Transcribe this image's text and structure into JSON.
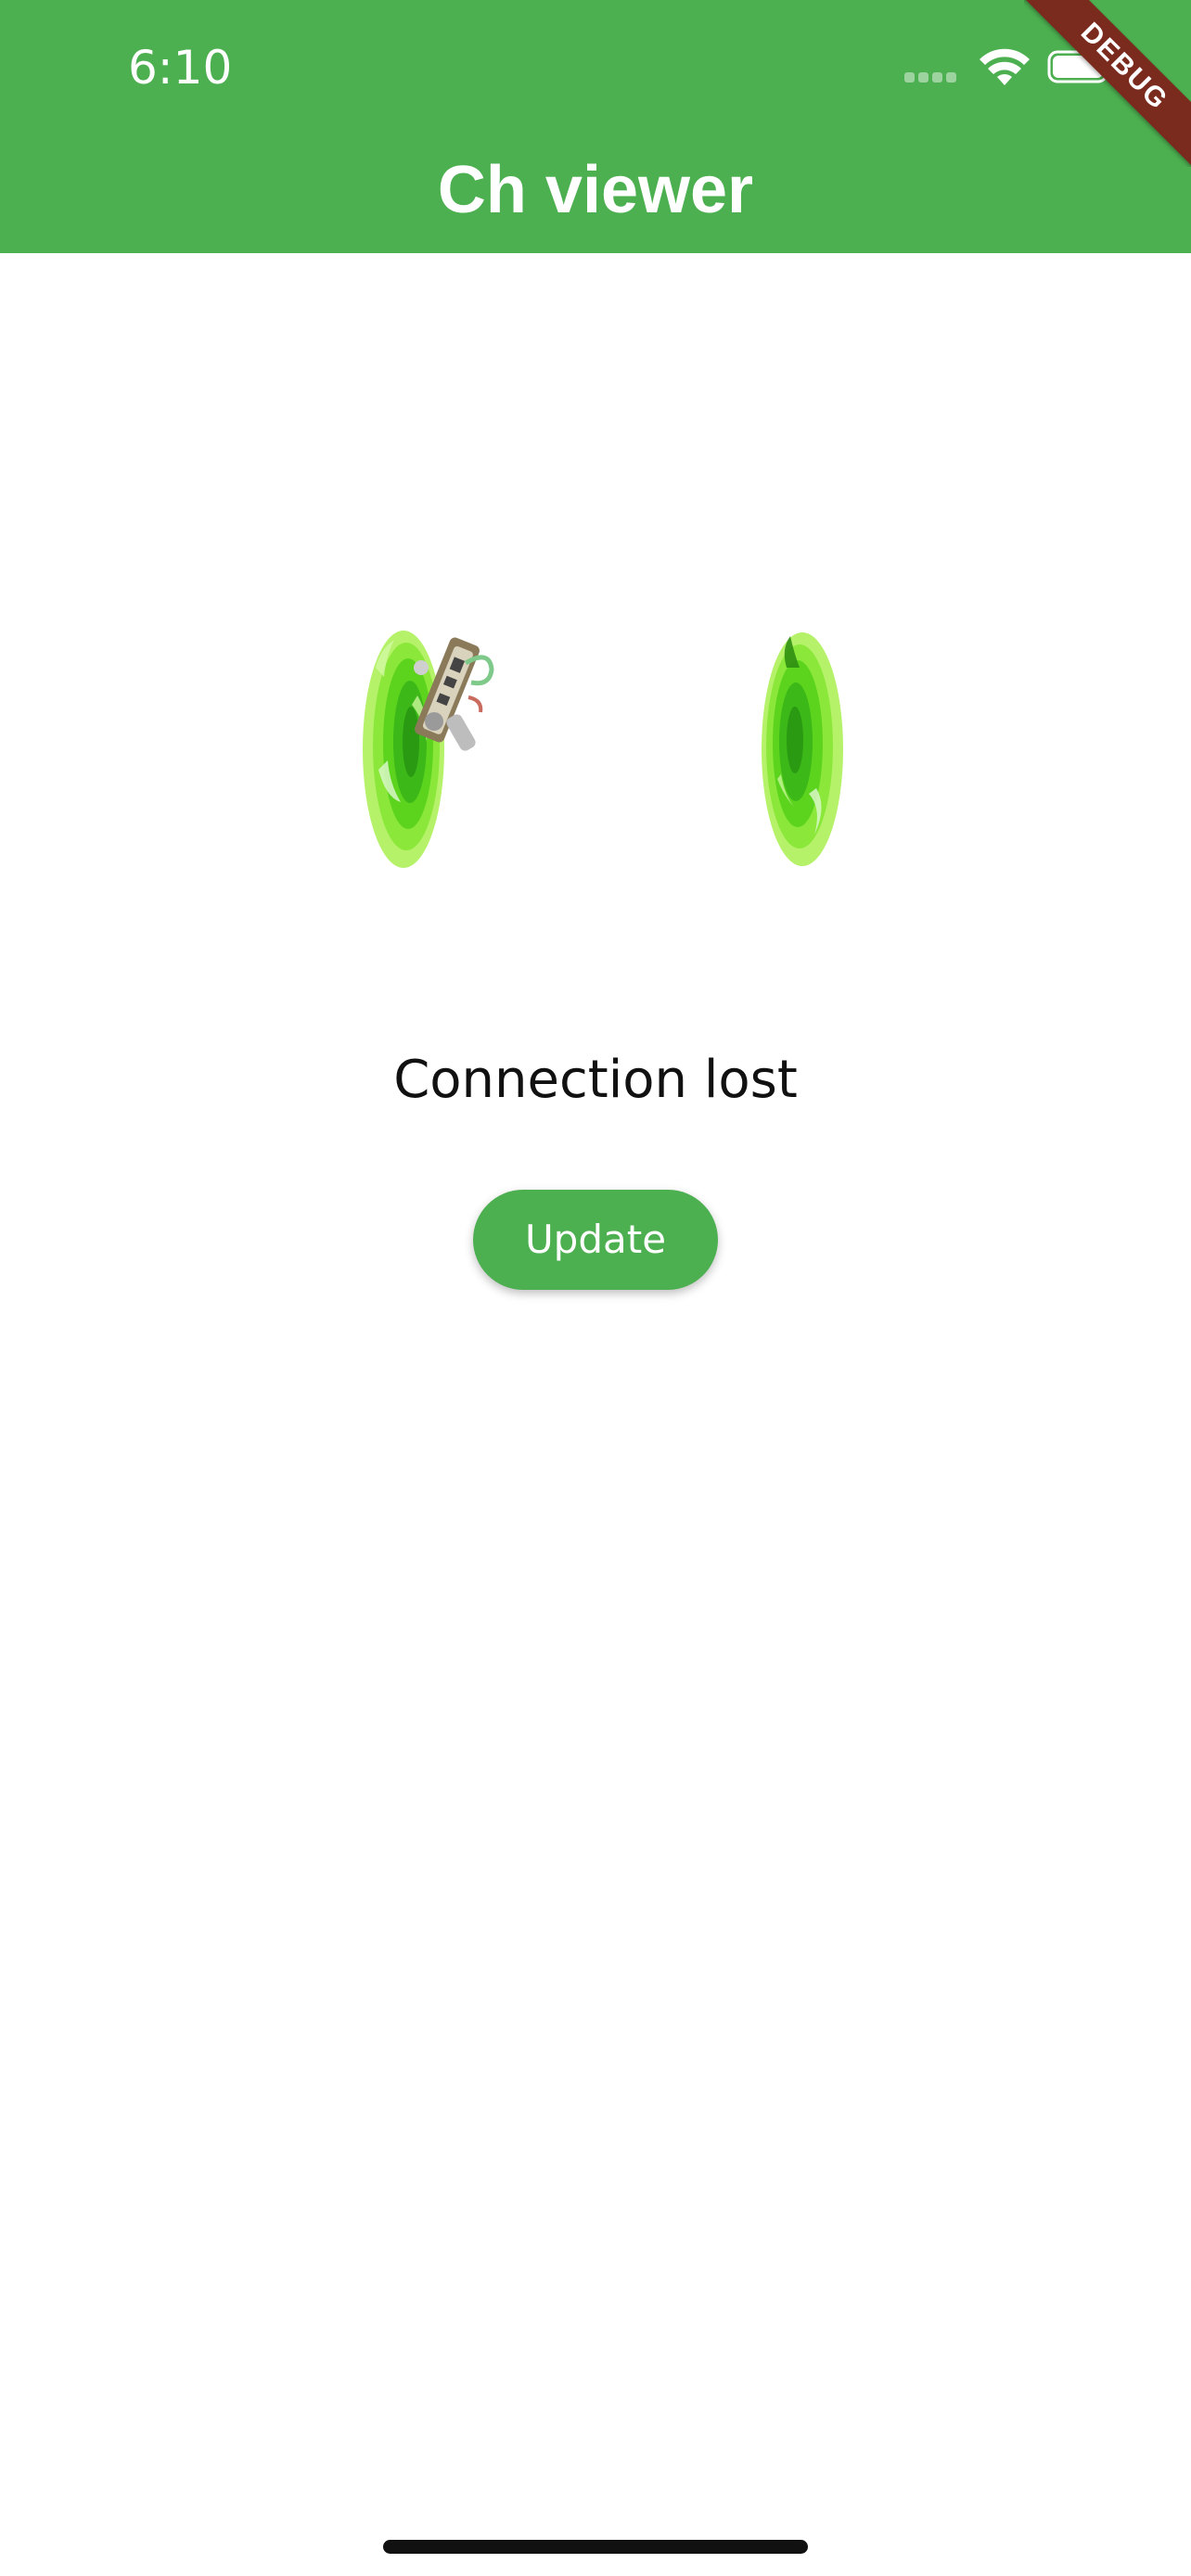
{
  "status_bar": {
    "time": "6:10",
    "icons": [
      "cellular-signal-icon",
      "wifi-icon",
      "battery-icon"
    ]
  },
  "app_bar": {
    "title": "Ch viewer",
    "color": "#4caf50"
  },
  "debug_banner": {
    "label": "DEBUG",
    "color": "#7b2a1e"
  },
  "main": {
    "illustration": "portal-illustration",
    "message": "Connection lost",
    "update_button_label": "Update",
    "accent_color": "#4caf50"
  }
}
